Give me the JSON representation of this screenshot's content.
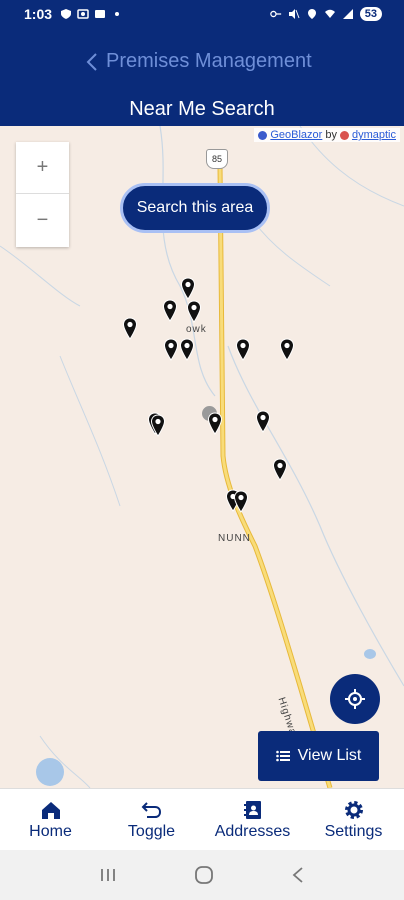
{
  "status_bar": {
    "time": "1:03",
    "battery": "53"
  },
  "header": {
    "back_label": "Premises Management",
    "title": "Near Me Search"
  },
  "map": {
    "attribution": {
      "geoblazor": "GeoBlazor",
      "by": "by",
      "dymaptic": "dymaptic"
    },
    "zoom_in": "+",
    "zoom_out": "−",
    "search_button": "Search this area",
    "town_label": "NUNN",
    "town_label_partial": "owk",
    "highway_shield": "85",
    "highway_label": "Highway",
    "view_list_label": "View List"
  },
  "bottom_nav": {
    "items": [
      {
        "label": "Home",
        "icon": "home-icon"
      },
      {
        "label": "Toggle",
        "icon": "toggle-icon"
      },
      {
        "label": "Addresses",
        "icon": "address-book-icon"
      },
      {
        "label": "Settings",
        "icon": "gear-icon"
      }
    ]
  },
  "colors": {
    "brand": "#0a2b7a",
    "accent": "#6f8fd8",
    "map_bg": "#f6ece4",
    "road": "#f2c94c"
  }
}
